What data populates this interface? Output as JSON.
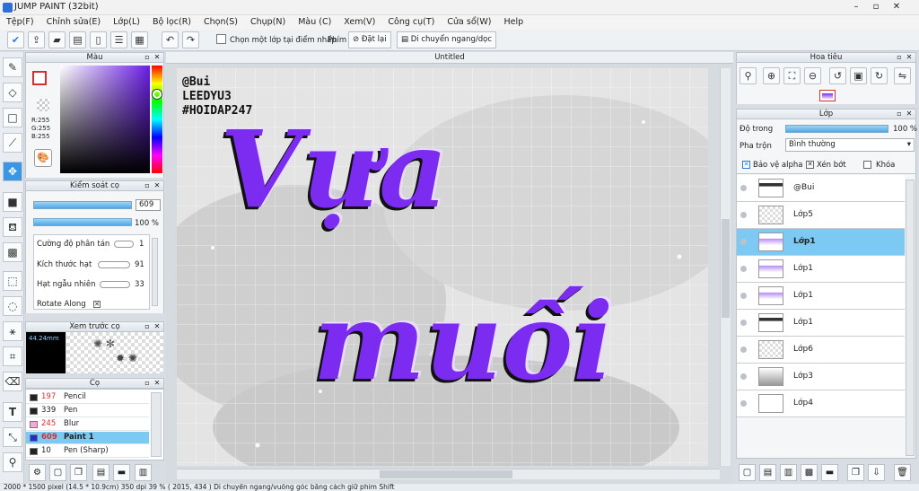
{
  "window": {
    "title": "JUMP PAINT (32bit)"
  },
  "menu": [
    "Tệp(F)",
    "Chỉnh sửa(E)",
    "Lớp(L)",
    "Bộ lọc(R)",
    "Chọn(S)",
    "Chụp(N)",
    "Màu (C)",
    "Xem(V)",
    "Công cụ(T)",
    "Cửa sổ(W)",
    "Help"
  ],
  "toolbar": {
    "select_one_layer": "Chọn một lớp tại điểm nhấp",
    "key_label": "Phím",
    "reset": "Đặt lại",
    "move_hv": "Di chuyển ngang/dọc"
  },
  "color_panel": {
    "title": "Màu",
    "r": "R:255",
    "g": "G:255",
    "b": "B:255"
  },
  "brush_control": {
    "title": "Kiểm soát cọ",
    "size_value": "609",
    "opacity_value": "100 %",
    "params": [
      {
        "label": "Cường độ phân tán",
        "value": "1"
      },
      {
        "label": "Kích thước hạt",
        "value": "91"
      },
      {
        "label": "Hạt ngẫu nhiên",
        "value": "33"
      }
    ],
    "rotate_label": "Rotate Along"
  },
  "brush_preview": {
    "title": "Xem trước cọ",
    "size_text": "44.24mm"
  },
  "brush_list": {
    "title": "Cọ",
    "items": [
      {
        "num": "197",
        "name": "Pencil",
        "color": "#222222",
        "num_color": "#d23030",
        "selected": false
      },
      {
        "num": "339",
        "name": "Pen",
        "color": "#222222",
        "num_color": "#222222",
        "selected": false
      },
      {
        "num": "245",
        "name": "Blur",
        "color": "#f6a8dc",
        "num_color": "#d23030",
        "selected": false
      },
      {
        "num": "609",
        "name": "Paint 1",
        "color": "#1e2fd0",
        "num_color": "#d23030",
        "selected": true
      },
      {
        "num": "10",
        "name": "Pen (Sharp)",
        "color": "#222222",
        "num_color": "#222222",
        "selected": false
      }
    ]
  },
  "canvas": {
    "tab": "Untitled",
    "watermark": [
      "@Bui",
      "LEEDYU3",
      "#HOIDAP247"
    ],
    "word1": "Vựa",
    "word2": "muối",
    "accent": "#7b2cf0"
  },
  "navigator": {
    "title": "Hoa tiêu"
  },
  "layer_panel": {
    "title": "Lớp",
    "opacity_label": "Độ trong",
    "opacity_value": "100 %",
    "blend_label": "Pha trộn",
    "blend_value": "Bình thường",
    "protect_alpha": "Bảo vệ alpha",
    "clipping": "Xén bớt",
    "lock": "Khóa",
    "layers": [
      {
        "name": "@Bui",
        "selected": false
      },
      {
        "name": "Lớp5",
        "selected": false
      },
      {
        "name": "Lớp1",
        "selected": true
      },
      {
        "name": "Lớp1",
        "selected": false
      },
      {
        "name": "Lớp1",
        "selected": false
      },
      {
        "name": "Lớp1",
        "selected": false
      },
      {
        "name": "Lớp6",
        "selected": false
      },
      {
        "name": "Lớp3",
        "selected": false
      },
      {
        "name": "Lớp4",
        "selected": false
      }
    ]
  },
  "status": {
    "text": "2000 * 1500 pixel  (14.5 * 10.9cm)  350 dpi  39 %  ( 2015, 434 )  Di chuyển ngang/vuông góc bằng cách giữ phím Shift"
  }
}
